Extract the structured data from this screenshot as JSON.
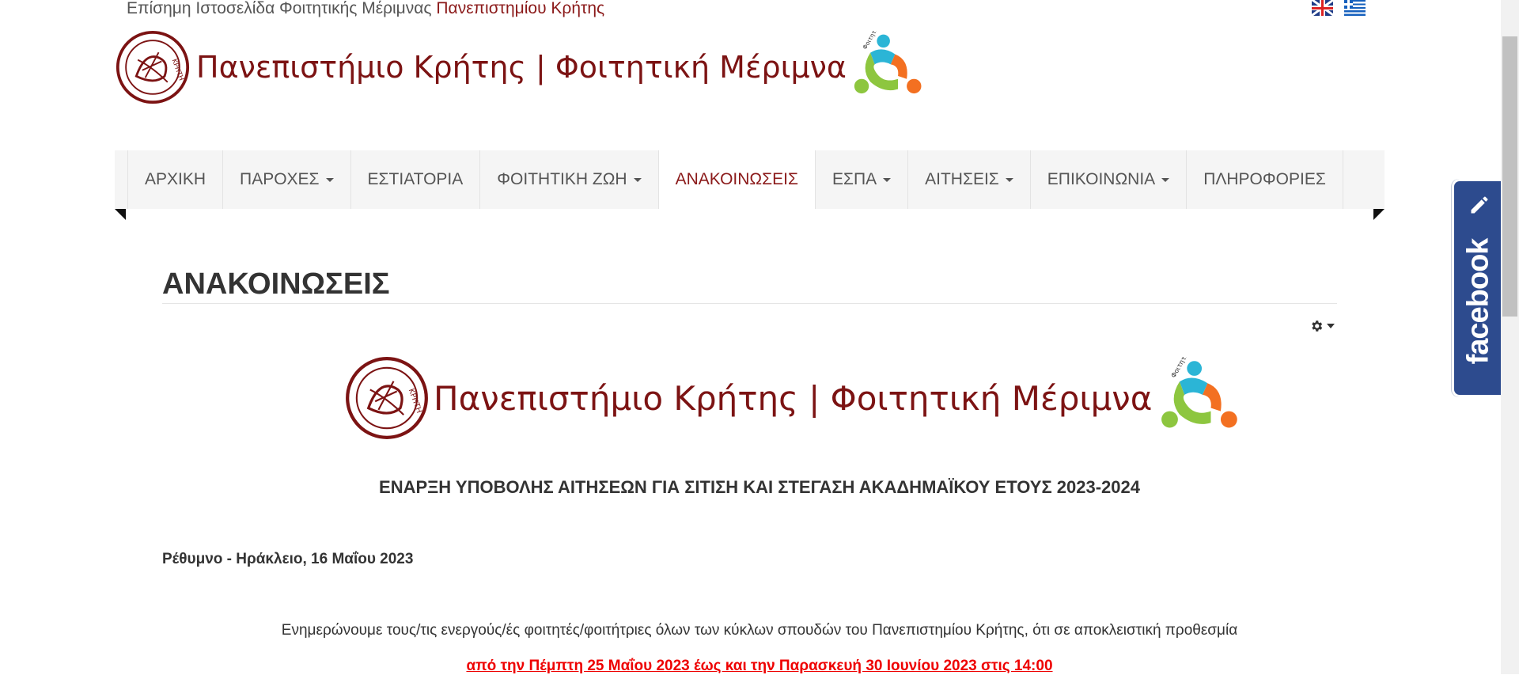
{
  "topbar": {
    "intro": "Επίσημη Ιστοσελίδα Φοιτητικής Μέριμνας",
    "university": "Πανεπιστημίου Κρήτης"
  },
  "languages": [
    "english-flag",
    "greek-flag"
  ],
  "logo": {
    "name": "Πανεπιστήμιο Κρήτης | Φοιτητική Μέριμνα",
    "seal_text": "ΚΡΗΤΗ",
    "emblem_text": "Φοιτητική Μέριμνα"
  },
  "nav": {
    "items": [
      {
        "label": "ΑΡΧΙΚΗ",
        "dropdown": false
      },
      {
        "label": "ΠΑΡΟΧΕΣ",
        "dropdown": true
      },
      {
        "label": "ΕΣΤΙΑΤΟΡΙΑ",
        "dropdown": false
      },
      {
        "label": "ΦΟΙΤΗΤΙΚΗ ΖΩΗ",
        "dropdown": true
      },
      {
        "label": "ΑΝΑΚΟΙΝΩΣΕΙΣ",
        "dropdown": false,
        "active": true
      },
      {
        "label": "ΕΣΠΑ",
        "dropdown": true
      },
      {
        "label": "ΑΙΤΗΣΕΙΣ",
        "dropdown": true
      },
      {
        "label": "ΕΠΙΚΟΙΝΩΝΙΑ",
        "dropdown": true
      },
      {
        "label": "ΠΛΗΡΟΦΟΡΙΕΣ",
        "dropdown": false
      }
    ]
  },
  "page": {
    "title": "ΑΝΑΚΟΙΝΩΣΕΙΣ",
    "tools_icon": "gear-icon"
  },
  "article": {
    "heading": "ΕΝΑΡΞΗ ΥΠΟΒΟΛΗΣ ΑΙΤΗΣΕΩΝ ΓΙΑ ΣΙΤΙΣΗ ΚΑΙ ΣΤΕΓΑΣΗ ΑΚΑΔΗΜΑΪΚΟΥ ΕΤΟΥΣ 2023-2024",
    "dateline": "Ρέθυμνο - Ηράκλειο, 16 Μαΐου 2023",
    "paragraph": "Ενημερώνουμε τους/τις ενεργούς/ές φοιτητές/φοιτήτριες όλων των κύκλων σπουδών του Πανεπιστημίου Κρήτης, ότι σε αποκλειστική προθεσμία",
    "deadline": "από την Πέμπτη 25 Μαΐου 2023 έως και την Παρασκευή 30 Ιουνίου 2023 στις 14:00"
  },
  "facebook": {
    "label": "facebook"
  },
  "colors": {
    "brand": "#7c1313",
    "nav_bg": "#f5f5f5",
    "facebook": "#2d4b8e",
    "deadline": "#ee0000"
  }
}
